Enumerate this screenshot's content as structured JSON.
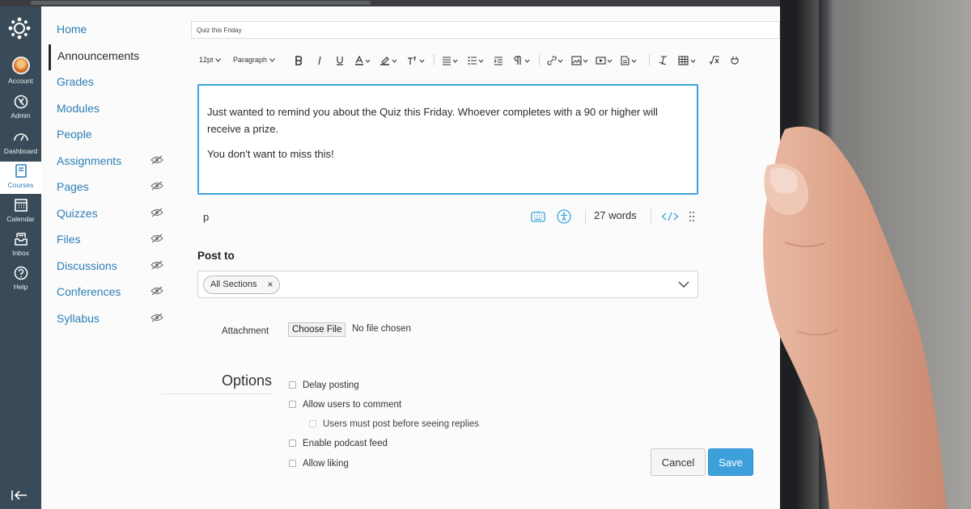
{
  "global_nav": {
    "items": [
      {
        "label": "Account",
        "icon": "avatar"
      },
      {
        "label": "Admin",
        "icon": "admin-shield-icon"
      },
      {
        "label": "Dashboard",
        "icon": "dashboard-gauge-icon"
      },
      {
        "label": "Courses",
        "icon": "courses-book-icon",
        "active": true
      },
      {
        "label": "Calendar",
        "icon": "calendar-icon"
      },
      {
        "label": "Inbox",
        "icon": "inbox-icon"
      },
      {
        "label": "Help",
        "icon": "help-icon"
      }
    ]
  },
  "course_nav": {
    "items": [
      {
        "label": "Home"
      },
      {
        "label": "Announcements",
        "active": true
      },
      {
        "label": "Grades"
      },
      {
        "label": "Modules"
      },
      {
        "label": "People"
      },
      {
        "label": "Assignments",
        "hidden_icon": true
      },
      {
        "label": "Pages",
        "hidden_icon": true
      },
      {
        "label": "Quizzes",
        "hidden_icon": true
      },
      {
        "label": "Files",
        "hidden_icon": true
      },
      {
        "label": "Discussions",
        "hidden_icon": true
      },
      {
        "label": "Conferences",
        "hidden_icon": true
      },
      {
        "label": "Syllabus",
        "hidden_icon": true
      }
    ]
  },
  "topic": {
    "title_value": "Quiz this Friday"
  },
  "toolbar": {
    "font_size": "12pt",
    "block_format": "Paragraph"
  },
  "editor": {
    "paragraphs": [
      "Just wanted to remind you about the Quiz this Friday. Whoever completes with a 90 or higher will receive a prize.",
      "You don't want to miss this!"
    ],
    "path": "p",
    "word_count": "27 words"
  },
  "post_to": {
    "label": "Post to",
    "selected_chip": "All Sections",
    "chip_remove": "×"
  },
  "attachment": {
    "label": "Attachment",
    "button_label": "Choose File",
    "status": "No file chosen"
  },
  "options": {
    "heading": "Options",
    "items": [
      {
        "label": "Delay posting"
      },
      {
        "label": "Allow users to comment"
      },
      {
        "label": "Users must post before seeing replies"
      },
      {
        "label": "Enable podcast feed"
      },
      {
        "label": "Allow liking"
      }
    ]
  },
  "actions": {
    "cancel_label": "Cancel",
    "save_label": "Save"
  },
  "colors": {
    "link_blue": "#2d7fb5",
    "nav_background": "#394b58",
    "editor_focus": "#3ba4d7",
    "save_button": "#3ea0db"
  }
}
